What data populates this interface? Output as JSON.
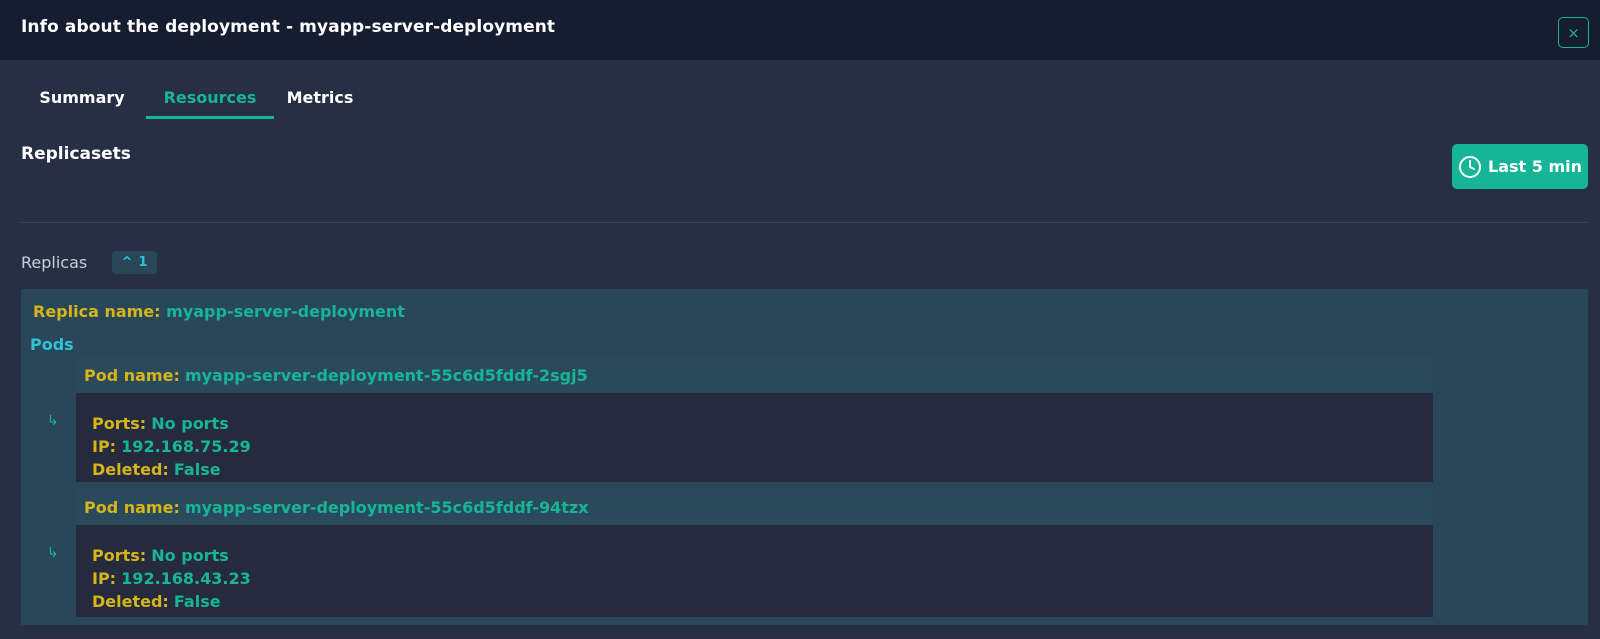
{
  "header": {
    "title": "Info about the deployment - myapp-server-deployment",
    "close_symbol": "×"
  },
  "tabs": [
    {
      "label": "Summary",
      "active": false
    },
    {
      "label": "Resources",
      "active": true
    },
    {
      "label": "Metrics",
      "active": false
    }
  ],
  "section": {
    "title": "Replicasets"
  },
  "time_filter": {
    "label": "Last 5 min",
    "icon": "clock-icon"
  },
  "replicas": {
    "label": "Replicas",
    "count": "1",
    "toggle_symbol": "^"
  },
  "replica": {
    "name_label": "Replica name:",
    "name": "myapp-server-deployment",
    "pods_label": "Pods",
    "pods": [
      {
        "name_label": "Pod name:",
        "name": "myapp-server-deployment-55c6d5fddf-2sgj5",
        "ports_label": "Ports:",
        "ports": "No ports",
        "ip_label": "IP:",
        "ip": "192.168.75.29",
        "deleted_label": "Deleted:",
        "deleted": "False"
      },
      {
        "name_label": "Pod name:",
        "name": "myapp-server-deployment-55c6d5fddf-94tzx",
        "ports_label": "Ports:",
        "ports": "No ports",
        "ip_label": "IP:",
        "ip": "192.168.43.23",
        "deleted_label": "Deleted:",
        "deleted": "False"
      }
    ]
  },
  "colors": {
    "accent": "#16b597",
    "label_yellow": "#d6b51a",
    "pods_cyan": "#2ec4d6"
  }
}
